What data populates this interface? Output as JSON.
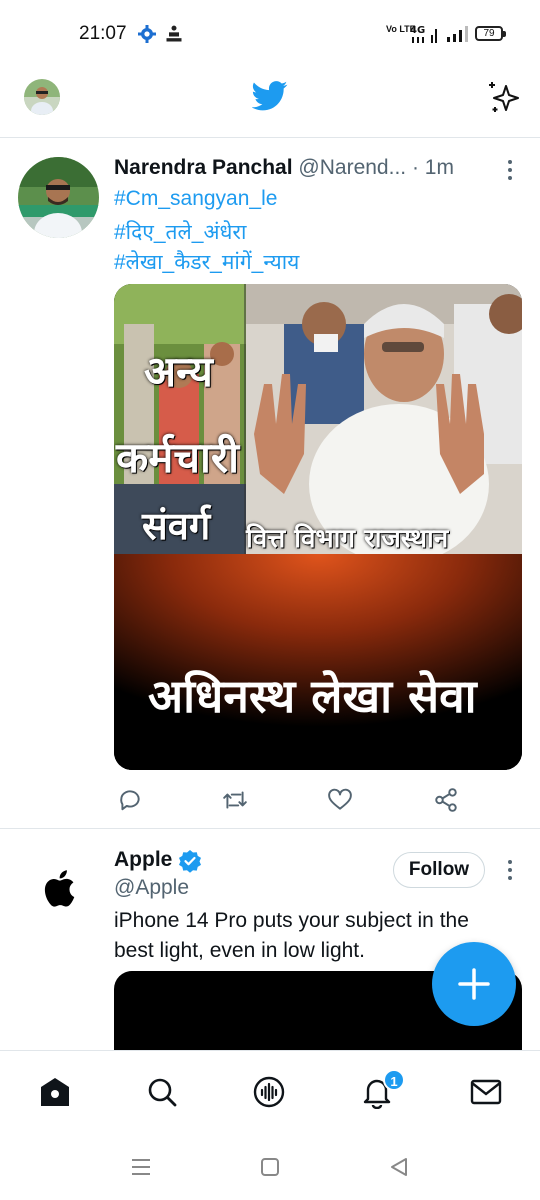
{
  "status_bar": {
    "time": "21:07",
    "network_volte": "Vo LTE",
    "network_type": "4G",
    "battery": "79"
  },
  "header": {
    "logo_icon": "twitter-bird-icon",
    "sparkle_icon": "sparkle-icon"
  },
  "tweets": [
    {
      "name": "Narendra Panchal",
      "handle": "@Narend...",
      "time": "· 1m",
      "hashtags": [
        "#Cm_sangyan_le",
        "#दिए_तले_अंधेरा",
        "#लेखा_कैडर_मांगें_न्याय"
      ],
      "media_text": {
        "left_line1": "अन्य",
        "left_line2": "कर्मचारी",
        "left_line3": "संवर्ग",
        "right": "वित्त विभाग राजस्थान",
        "bottom": "अधिनस्थ लेखा सेवा"
      }
    },
    {
      "name": "Apple",
      "handle": "@Apple",
      "follow_label": "Follow",
      "text": "iPhone 14 Pro puts your subject in the best light, even in low light."
    }
  ],
  "bottom_nav": {
    "notification_count": "1"
  },
  "colors": {
    "accent": "#1d9bf0",
    "text": "#0f1419",
    "muted": "#536471",
    "divider": "#e1e6ea"
  }
}
